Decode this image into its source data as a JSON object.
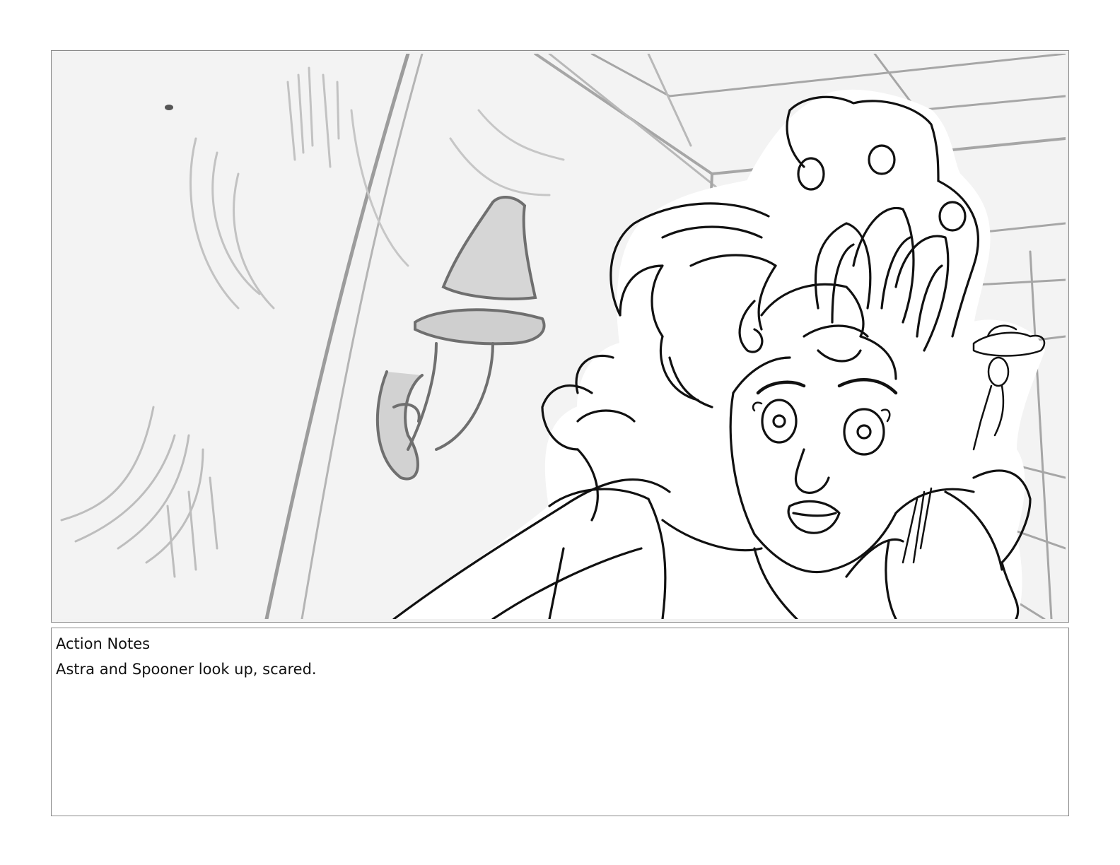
{
  "panel": {
    "image": "storyboard-panel-sketch",
    "icon": "storyboard-drawing"
  },
  "notes": {
    "label": "Action Notes",
    "text": "Astra and Spooner look up, scared."
  }
}
